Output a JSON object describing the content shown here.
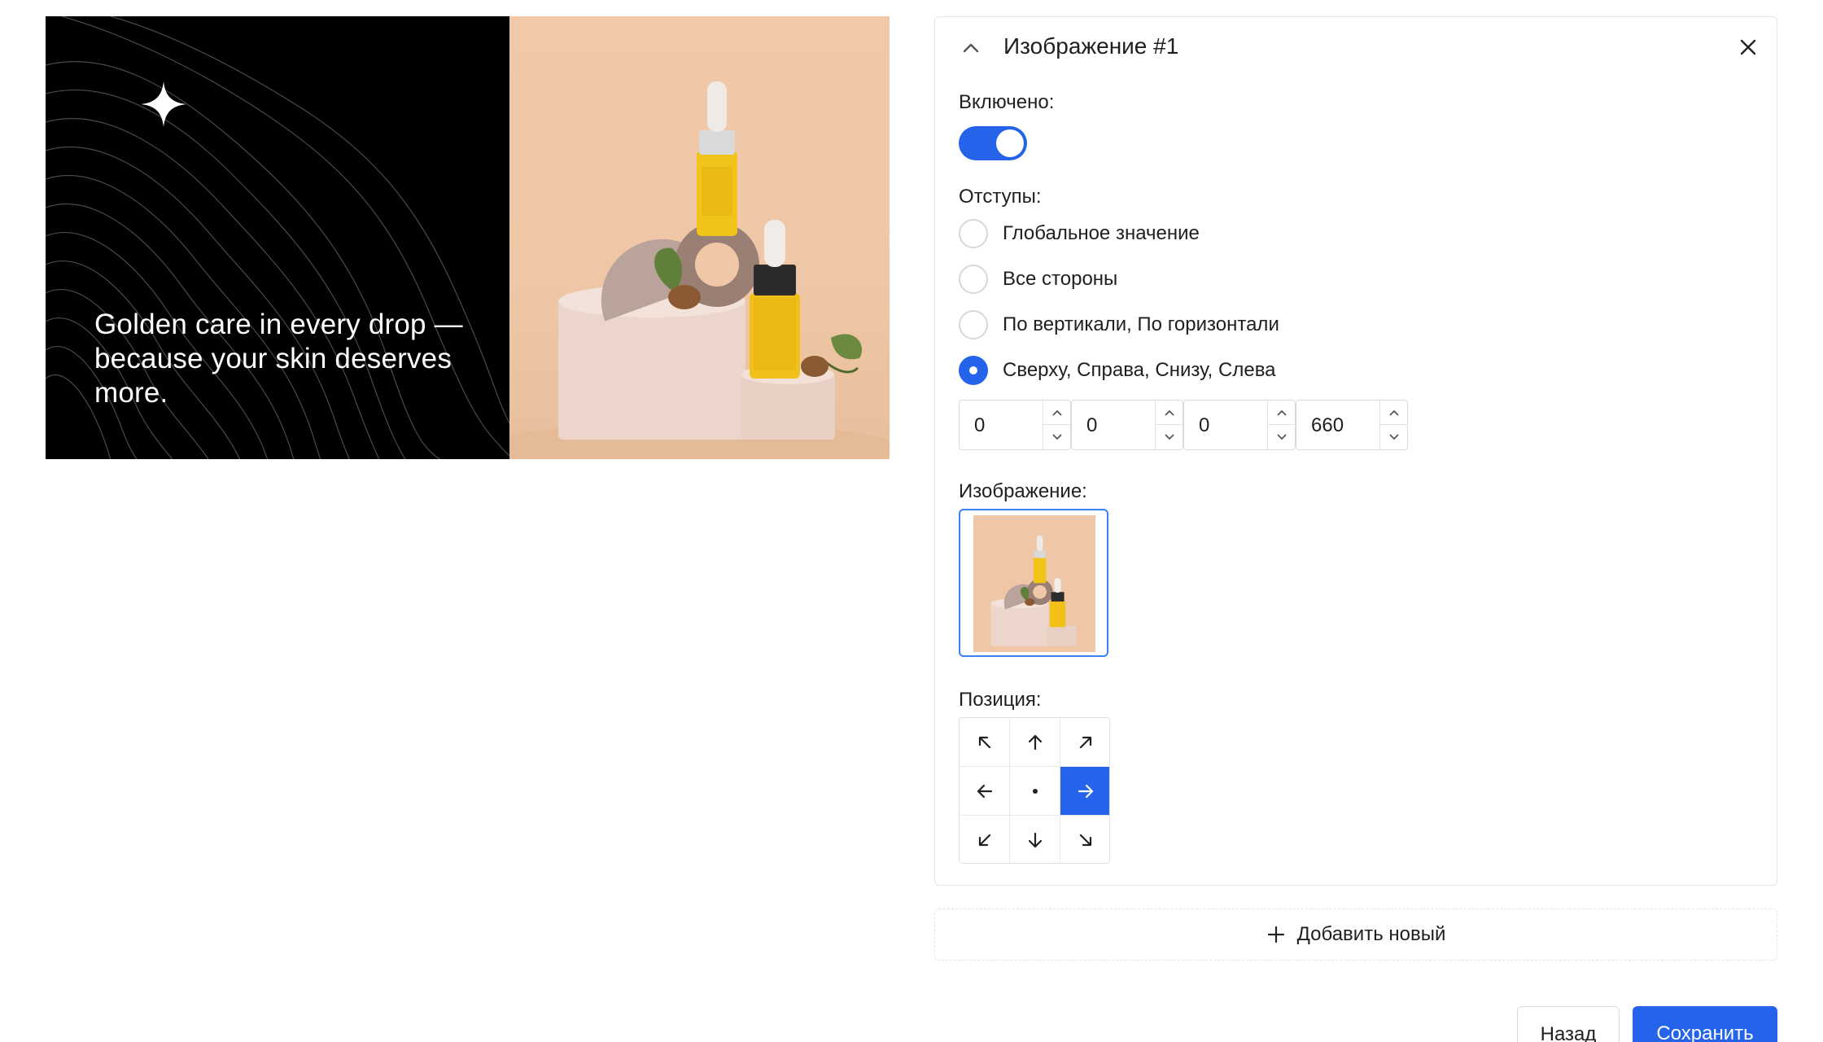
{
  "preview": {
    "banner_text": "Golden care in every drop — because your skin deserves more."
  },
  "card": {
    "title": "Изображение #1",
    "collapse_icon": "chevron-up-icon",
    "close_icon": "close-icon",
    "enabled_label": "Включено:",
    "enabled": true,
    "padding_label": "Отступы:",
    "padding_options": [
      {
        "label": "Глобальное значение",
        "checked": false
      },
      {
        "label": "Все стороны",
        "checked": false
      },
      {
        "label": "По вертикали, По горизонтали",
        "checked": false
      },
      {
        "label": "Сверху, Справа, Снизу, Слева",
        "checked": true
      }
    ],
    "padding_values": [
      "0",
      "0",
      "0",
      "660"
    ],
    "image_label": "Изображение:",
    "position_label": "Позиция:",
    "position_grid": [
      "arrow-up-left-icon",
      "arrow-up-icon",
      "arrow-up-right-icon",
      "arrow-left-icon",
      "center-dot-icon",
      "arrow-right-icon",
      "arrow-down-left-icon",
      "arrow-down-icon",
      "arrow-down-right-icon"
    ],
    "position_selected": "arrow-right-icon"
  },
  "add_new": {
    "label": "Добавить новый",
    "icon": "plus-icon"
  },
  "footer": {
    "back_label": "Назад",
    "save_label": "Сохранить"
  },
  "colors": {
    "accent": "#2563eb",
    "border": "#e3e5e8",
    "banner_bg": "#000000",
    "product_bg": "#efc7a6"
  }
}
